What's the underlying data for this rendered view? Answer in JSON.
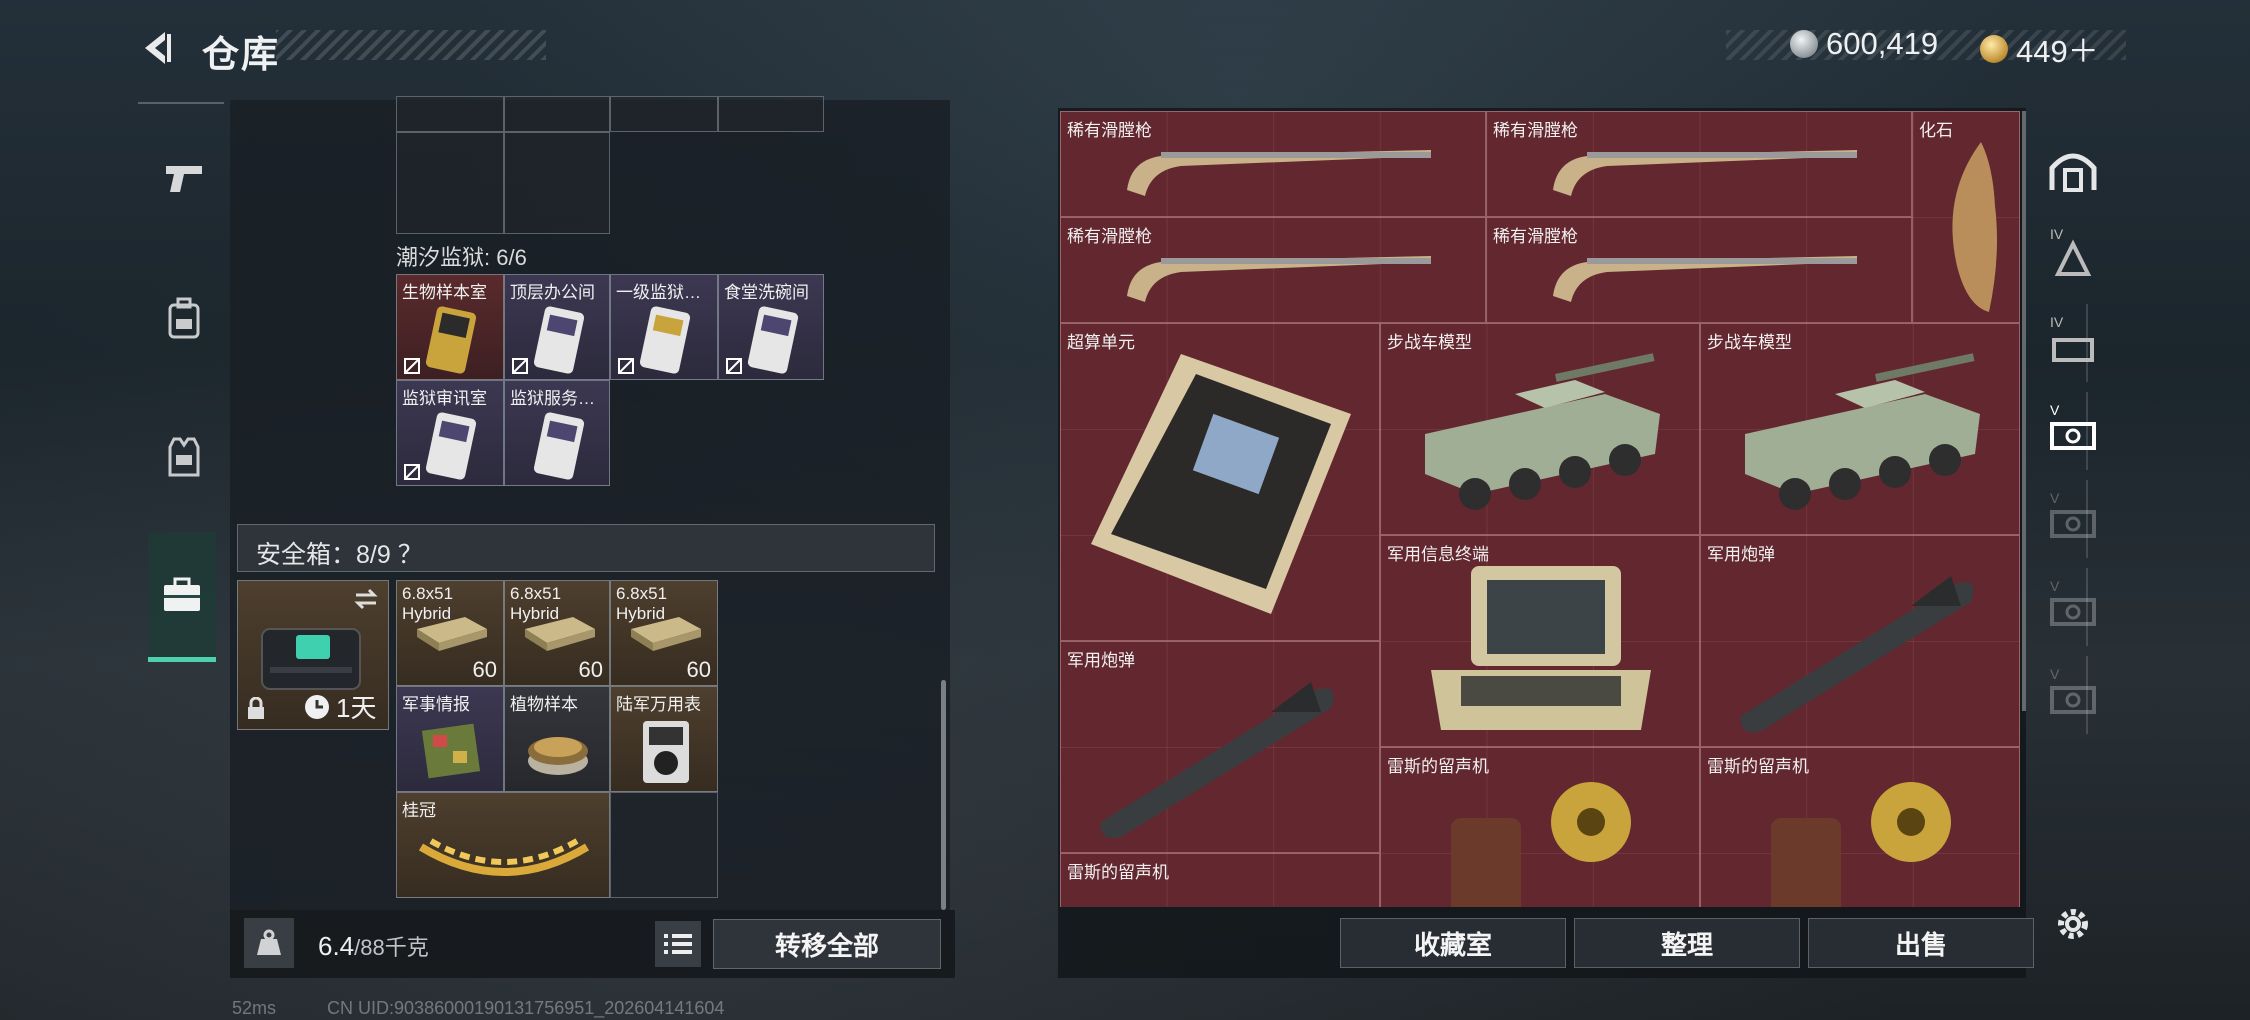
{
  "header": {
    "title": "仓库",
    "back_icon": "back-arrow-icon",
    "currency": [
      {
        "icon": "silver-coin-icon",
        "value": "600,419"
      },
      {
        "icon": "gold-coin-icon",
        "value": "449＋"
      }
    ]
  },
  "left_tabs": [
    {
      "icon": "pistol-icon",
      "active": false
    },
    {
      "icon": "backpack-icon",
      "active": false
    },
    {
      "icon": "vest-icon",
      "active": false
    },
    {
      "icon": "briefcase-icon",
      "active": true
    }
  ],
  "keys_section": {
    "label": "潮汐监狱: 6/6",
    "items": [
      {
        "label": "生物样本室",
        "color": "red"
      },
      {
        "label": "顶层办公间",
        "color": "purple"
      },
      {
        "label": "一级监狱…",
        "color": "purple"
      },
      {
        "label": "食堂洗碗间",
        "color": "purple"
      },
      {
        "label": "监狱审讯室",
        "color": "purple"
      },
      {
        "label": "监狱服务…",
        "color": "purple"
      }
    ]
  },
  "safe_box": {
    "label": "安全箱：8/9 ？",
    "timer": "1天",
    "ammo": [
      {
        "label": "6.8x51 Hybrid",
        "count": "60"
      },
      {
        "label": "6.8x51 Hybrid",
        "count": "60"
      },
      {
        "label": "6.8x51 Hybrid",
        "count": "60"
      }
    ],
    "items": [
      {
        "label": "军事情报"
      },
      {
        "label": "植物样本"
      },
      {
        "label": "陆军万用表"
      },
      {
        "label": "桂冠"
      }
    ]
  },
  "footer_left": {
    "weight_value": "6.4",
    "weight_unit": "/88千克",
    "transfer_all": "转移全部"
  },
  "stash_items": [
    {
      "label": "稀有滑膛枪"
    },
    {
      "label": "稀有滑膛枪"
    },
    {
      "label": "化石"
    },
    {
      "label": "稀有滑膛枪"
    },
    {
      "label": "稀有滑膛枪"
    },
    {
      "label": "超算单元"
    },
    {
      "label": "步战车模型"
    },
    {
      "label": "步战车模型"
    },
    {
      "label": "军用信息终端"
    },
    {
      "label": "军用炮弹"
    },
    {
      "label": "军用炮弹"
    },
    {
      "label": "雷斯的留声机"
    },
    {
      "label": "雷斯的留声机"
    },
    {
      "label": "雷斯的留声机"
    }
  ],
  "footer_right": {
    "collection": "收藏室",
    "sort": "整理",
    "sell": "出售"
  },
  "right_tabs": [
    {
      "icon": "home-storage-icon",
      "tier": ""
    },
    {
      "icon": "storage-tier-icon",
      "tier": "IV"
    },
    {
      "icon": "storage-tier-icon",
      "tier": "IV"
    },
    {
      "icon": "storage-tier-icon",
      "tier": "V",
      "active": true
    },
    {
      "icon": "storage-tier-icon",
      "tier": "V"
    },
    {
      "icon": "storage-tier-icon",
      "tier": "V"
    },
    {
      "icon": "storage-tier-icon",
      "tier": "V"
    },
    {
      "icon": "gear-icon",
      "tier": ""
    }
  ],
  "status": {
    "ping": "52ms",
    "uid": "CN UID:903860001901317569​51_202604141604"
  },
  "colors": {
    "accent_teal": "#4fd1b0",
    "stash_red": "#5a292e",
    "key_red": "#5a2a2c",
    "key_purple": "#3d3852"
  }
}
